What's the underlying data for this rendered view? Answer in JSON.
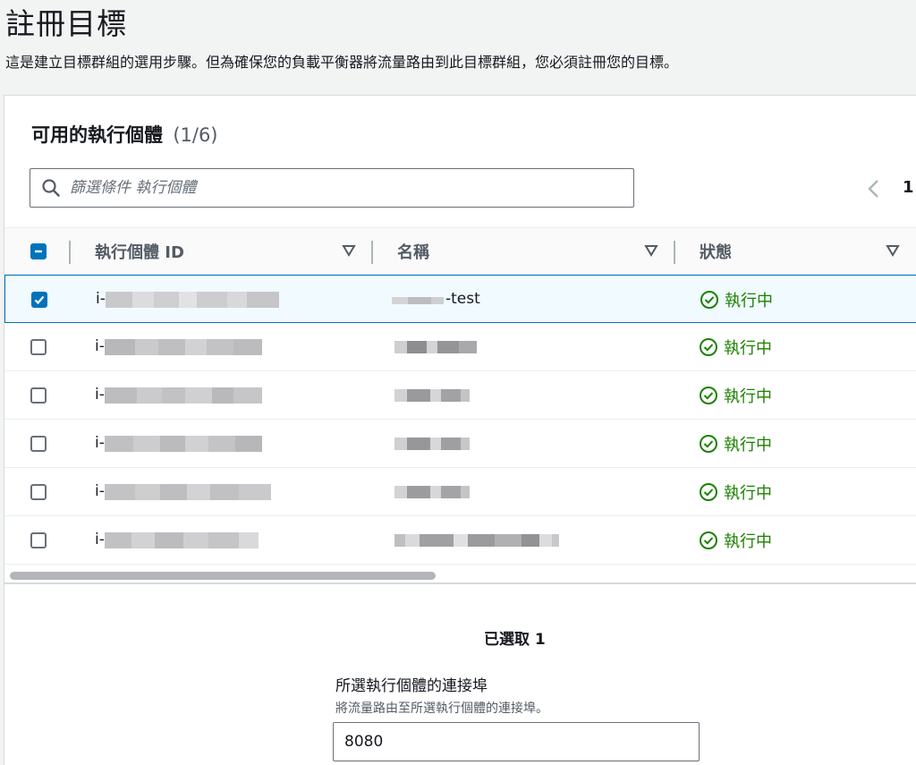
{
  "page": {
    "title": "註冊目標",
    "description": "這是建立目標群組的選用步驟。但為確保您的負載平衡器將流量路由到此目標群組，您必須註冊您的目標。"
  },
  "panel": {
    "title": "可用的執行個體",
    "count": "(1/6)",
    "search_placeholder": "篩選條件 執行個體",
    "page_number": "1"
  },
  "table": {
    "columns": [
      "執行個體 ID",
      "名稱",
      "狀態"
    ],
    "rows": [
      {
        "selected": true,
        "id_prefix": "i-",
        "name_suffix": "-test",
        "status": "執行中"
      },
      {
        "selected": false,
        "id_prefix": "i-",
        "name_suffix": "",
        "status": "執行中"
      },
      {
        "selected": false,
        "id_prefix": "i-",
        "name_suffix": "",
        "status": "執行中"
      },
      {
        "selected": false,
        "id_prefix": "i-",
        "name_suffix": "",
        "status": "執行中"
      },
      {
        "selected": false,
        "id_prefix": "i-",
        "name_suffix": "",
        "status": "執行中"
      },
      {
        "selected": false,
        "id_prefix": "i-",
        "name_suffix": "",
        "status": "執行中"
      }
    ]
  },
  "selection": {
    "selected_label": "已選取 1"
  },
  "port": {
    "label": "所選執行個體的連接埠",
    "description": "將流量路由至所選執行個體的連接埠。",
    "value": "8080"
  },
  "colors": {
    "accent": "#0073bb",
    "status_running": "#1d8102"
  }
}
